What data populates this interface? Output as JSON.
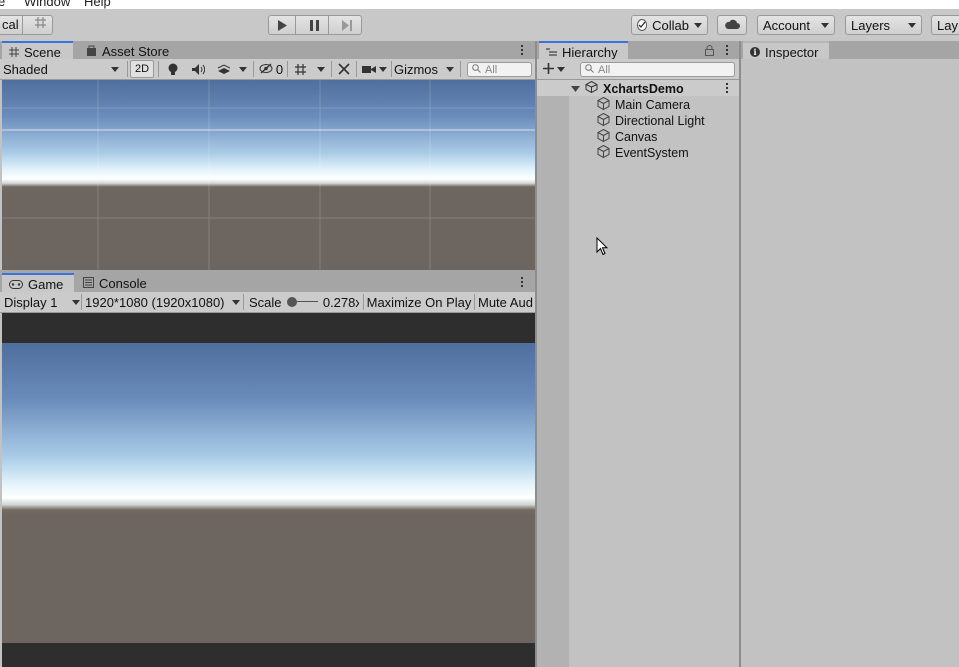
{
  "menu": {
    "left": "e",
    "window": "Window",
    "help": "Help"
  },
  "toolbar": {
    "local": "cal",
    "collab": "Collab",
    "account": "Account",
    "layers": "Layers",
    "layout": "Lay"
  },
  "scene": {
    "tabs": {
      "scene": "Scene",
      "asset_store": "Asset Store"
    },
    "shading": "Shaded",
    "mode_2d": "2D",
    "hidden_count": "0",
    "gizmos": "Gizmos",
    "search_placeholder": "All"
  },
  "game": {
    "tabs": {
      "game": "Game",
      "console": "Console"
    },
    "display": "Display 1",
    "resolution": "1920*1080 (1920x1080)",
    "scale_label": "Scale",
    "scale_value": "0.278x",
    "maximize": "Maximize On Play",
    "mute": "Mute Aud"
  },
  "hierarchy": {
    "tab": "Hierarchy",
    "search_placeholder": "All",
    "scene_name": "XchartsDemo",
    "items": [
      {
        "label": "Main Camera"
      },
      {
        "label": "Directional Light"
      },
      {
        "label": "Canvas"
      },
      {
        "label": "EventSystem"
      }
    ]
  },
  "inspector": {
    "tab": "Inspector"
  }
}
